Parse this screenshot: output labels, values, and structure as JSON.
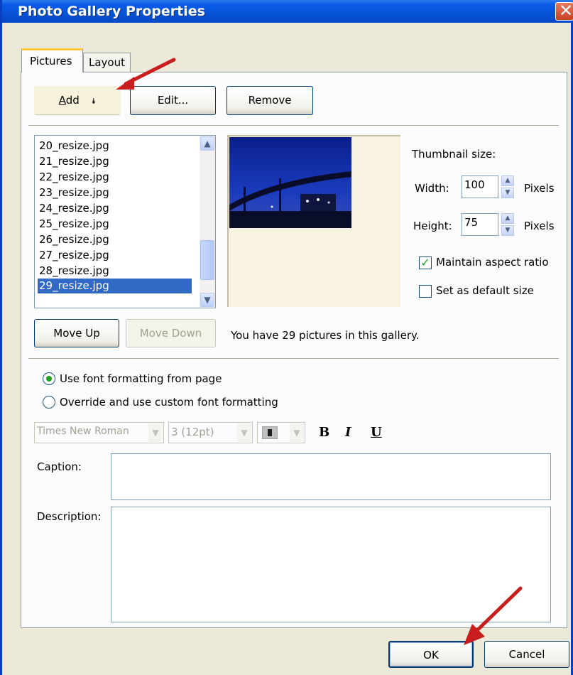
{
  "window": {
    "title": "Photo Gallery Properties",
    "close_icon": "✕"
  },
  "tabs": [
    {
      "label": "Pictures",
      "active": true
    },
    {
      "label": "Layout",
      "active": false
    }
  ],
  "toolbar": {
    "add_label": "Add",
    "add_mnemonic": "A",
    "add_rest": "dd",
    "add_chevron": "⯯",
    "edit_label": "Edit...",
    "remove_label": "Remove"
  },
  "picture_list": {
    "items": [
      "20_resize.jpg",
      "21_resize.jpg",
      "22_resize.jpg",
      "23_resize.jpg",
      "24_resize.jpg",
      "25_resize.jpg",
      "26_resize.jpg",
      "27_resize.jpg",
      "28_resize.jpg",
      "29_resize.jpg"
    ],
    "selected": "29_resize.jpg"
  },
  "thumbnail": {
    "heading": "Thumbnail size:",
    "width_label": "Width:",
    "width_value": "100",
    "width_unit": "Pixels",
    "height_label": "Height:",
    "height_value": "75",
    "height_unit": "Pixels",
    "maintain_aspect_label": "Maintain aspect ratio",
    "maintain_aspect_checked": true,
    "default_size_label": "Set as default size",
    "default_size_checked": false
  },
  "move": {
    "up_label": "Move Up",
    "down_label": "Move Down"
  },
  "status_text": "You have 29 pictures in this gallery.",
  "font_options": {
    "use_page_label": "Use font formatting from page",
    "use_page_selected": true,
    "override_label": "Override and use custom font formatting",
    "override_selected": false,
    "font_name": "Times New Roman",
    "font_size": "3 (12pt)",
    "bold_label": "B",
    "italic_label": "I",
    "underline_label": "U"
  },
  "caption": {
    "label": "Caption:",
    "value": ""
  },
  "description": {
    "label": "Description:",
    "value": ""
  },
  "footer": {
    "ok_label": "OK",
    "cancel_label": "Cancel"
  },
  "colors": {
    "titlebar": "#0653d6",
    "selection": "#316ac5",
    "annotation_arrow": "#c81e1e",
    "check": "#21a121"
  }
}
